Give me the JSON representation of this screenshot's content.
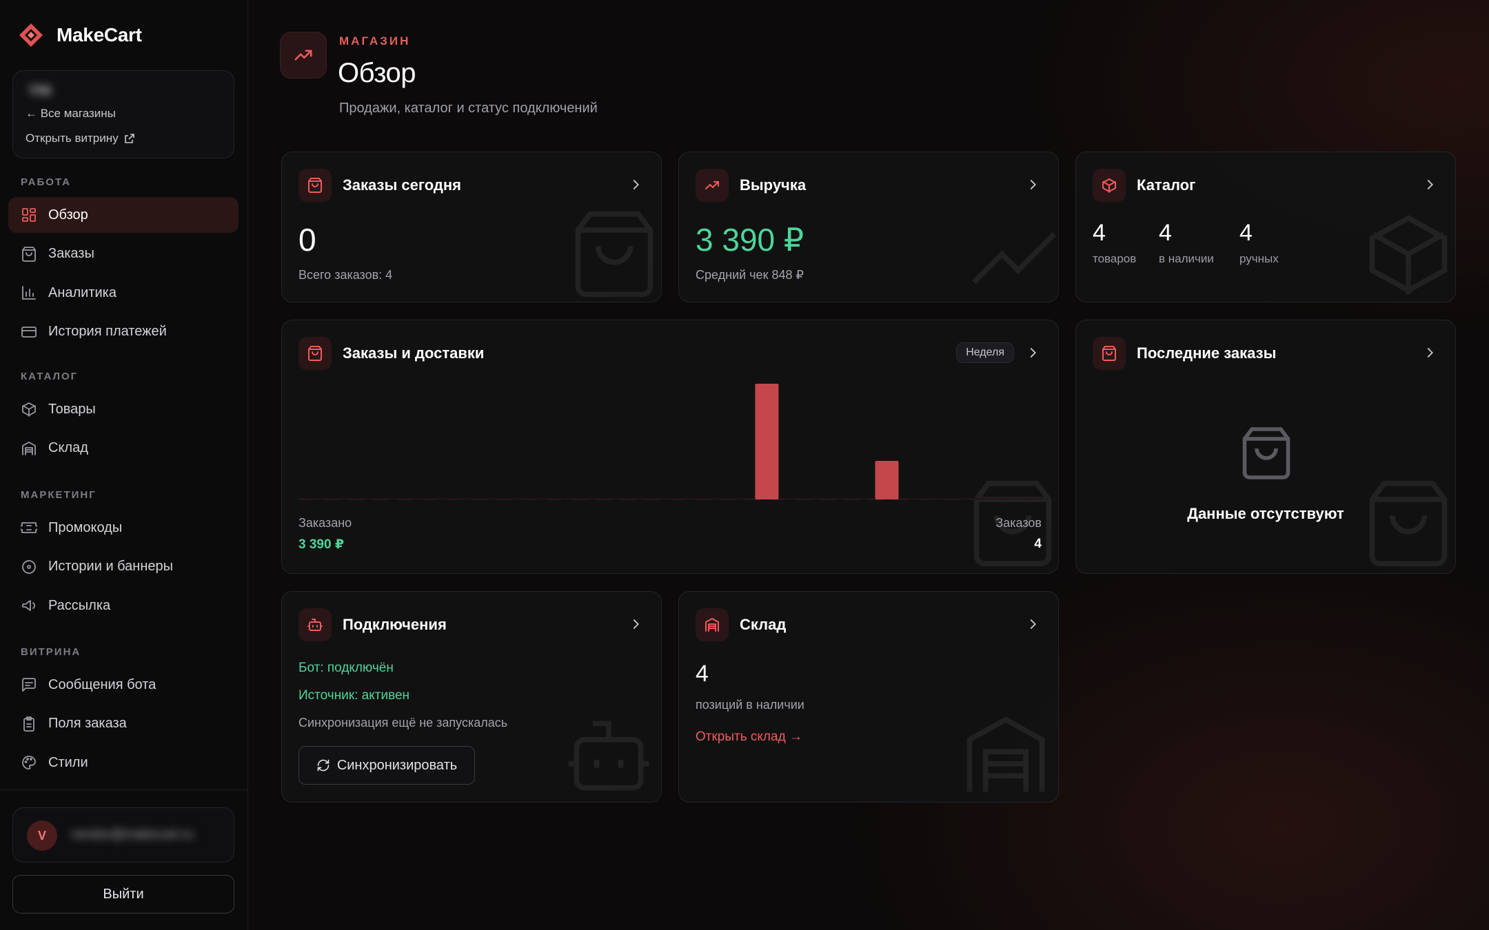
{
  "brand": {
    "name": "MakeCart",
    "accent": "#e0615d"
  },
  "store": {
    "name": "YNI",
    "back_label": "← Все магазины",
    "open_label": "Открыть витрину"
  },
  "nav": {
    "sections": [
      {
        "title": "РАБОТА",
        "items": [
          {
            "label": "Обзор",
            "icon": "dashboard-icon",
            "active": true
          },
          {
            "label": "Заказы",
            "icon": "shopping-bag-icon"
          },
          {
            "label": "Аналитика",
            "icon": "bar-chart-icon"
          },
          {
            "label": "История платежей",
            "icon": "credit-card-icon"
          }
        ]
      },
      {
        "title": "КАТАЛОГ",
        "items": [
          {
            "label": "Товары",
            "icon": "package-icon"
          },
          {
            "label": "Склад",
            "icon": "warehouse-icon"
          }
        ]
      },
      {
        "title": "МАРКЕТИНГ",
        "items": [
          {
            "label": "Промокоды",
            "icon": "ticket-icon"
          },
          {
            "label": "Истории и баннеры",
            "icon": "circle-play-icon"
          },
          {
            "label": "Рассылка",
            "icon": "megaphone-icon"
          }
        ]
      },
      {
        "title": "ВИТРИНА",
        "items": [
          {
            "label": "Сообщения бота",
            "icon": "message-icon"
          },
          {
            "label": "Поля заказа",
            "icon": "clipboard-icon"
          },
          {
            "label": "Стили",
            "icon": "palette-icon"
          }
        ]
      }
    ]
  },
  "user": {
    "initial": "V",
    "email": "vendor@makecart.ru"
  },
  "logout_label": "Выйти",
  "header": {
    "eyebrow": "МАГАЗИН",
    "title": "Обзор",
    "subtitle": "Продажи, каталог и статус подключений"
  },
  "cards": {
    "orders_today": {
      "title": "Заказы сегодня",
      "value": "0",
      "sub": "Всего заказов: 4"
    },
    "revenue": {
      "title": "Выручка",
      "value": "3 390 ₽",
      "sub": "Средний чек 848 ₽"
    },
    "catalog": {
      "title": "Каталог",
      "stats": [
        {
          "value": "4",
          "label": "товаров"
        },
        {
          "value": "4",
          "label": "в наличии"
        },
        {
          "value": "4",
          "label": "ручных"
        }
      ]
    },
    "orders_chart": {
      "title": "Заказы и доставки",
      "period": "Неделя",
      "ordered_label": "Заказано",
      "ordered_value": "3 390 ₽",
      "orders_label": "Заказов",
      "orders_value": "4"
    },
    "recent_orders": {
      "title": "Последние заказы",
      "empty": "Данные отсутствуют"
    },
    "connections": {
      "title": "Подключения",
      "bot_status": "Бот: подключён",
      "source_status": "Источник: активен",
      "sync_status": "Синхронизация ещё не запускалась",
      "sync_button": "Синхронизировать"
    },
    "warehouse": {
      "title": "Склад",
      "value": "4",
      "sub": "позиций в наличии",
      "link": "Открыть склад →"
    }
  },
  "chart_data": {
    "type": "bar",
    "values": [
      0,
      0,
      0,
      0,
      0,
      0,
      0,
      0,
      0,
      0,
      0,
      0,
      0,
      0,
      0,
      0,
      0,
      0,
      0,
      3,
      0,
      0,
      0,
      0,
      1,
      0,
      0,
      0,
      0,
      0,
      0
    ],
    "ylim": [
      0,
      3
    ],
    "bar_color": "#c4484b"
  },
  "colors": {
    "green": "#4ed49a",
    "red": "#ef5c5c"
  }
}
